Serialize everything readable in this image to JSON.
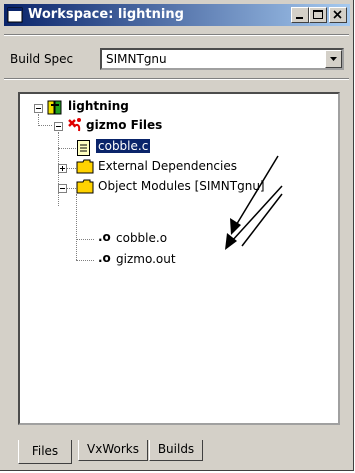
{
  "window": {
    "title": "Workspace: lightning",
    "controls": [
      "minimize-icon",
      "maximize-icon",
      "close-icon"
    ]
  },
  "build_spec": {
    "label": "Build Spec",
    "value": "SIMNTgnu"
  },
  "tree": {
    "root": "lightning",
    "project": "gizmo Files",
    "items": [
      {
        "label": "cobble.c",
        "icon": "source-file-icon",
        "selected": true
      },
      {
        "label": "External Dependencies",
        "icon": "folder-icon",
        "collapsed": true
      },
      {
        "label": "Object Modules [SIMNTgnu]",
        "icon": "folder-icon",
        "collapsed": false
      }
    ],
    "object_modules": [
      "cobble.o",
      "gizmo.out"
    ]
  },
  "tabs": [
    {
      "label": "Files",
      "active": true
    },
    {
      "label": "VxWorks",
      "active": false
    },
    {
      "label": "Builds",
      "active": false
    }
  ],
  "colors": {
    "titlebar": "#0a246a",
    "selection": "#0a246a",
    "face": "#d4d0c8",
    "folder": "#ffd200",
    "project_mark": "#e00000"
  }
}
